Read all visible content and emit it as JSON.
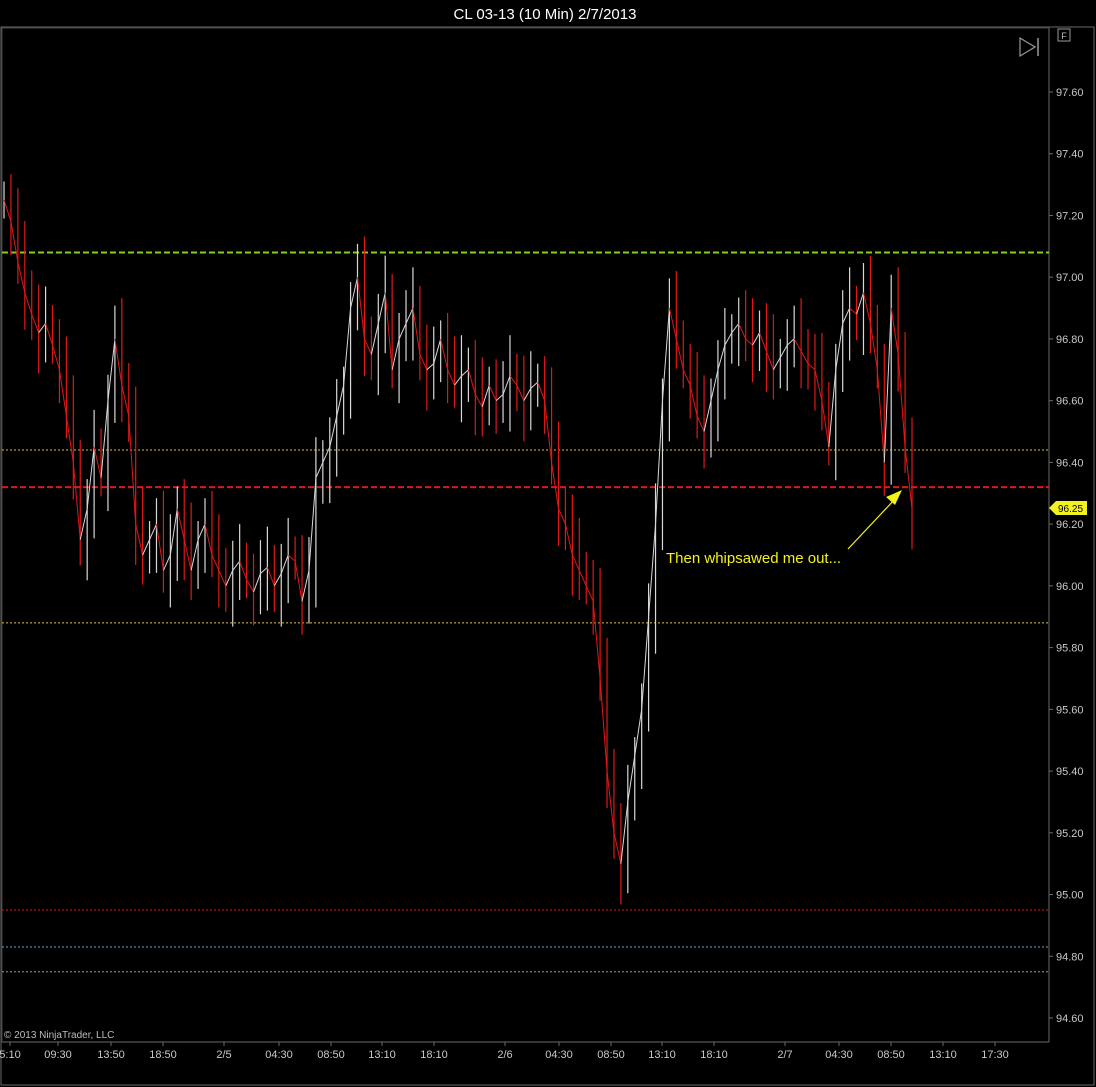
{
  "chart_data": {
    "type": "ohlc",
    "title": "CL 03-13 (10 Min)  2/7/2013",
    "watermark": "© 2013 NinjaTrader, LLC",
    "annotation": "Then whipsawed me out...",
    "current_price_label": "96.25",
    "x_tick_labels": [
      "5:10",
      "09:30",
      "13:50",
      "18:50",
      "2/5",
      "04:30",
      "08:50",
      "13:10",
      "18:10",
      "2/6",
      "04:30",
      "08:50",
      "13:10",
      "18:10",
      "2/7",
      "04:30",
      "08:50",
      "13:10",
      "17:30"
    ],
    "y_tick_labels": [
      "97.60",
      "97.40",
      "97.20",
      "97.00",
      "96.80",
      "96.60",
      "96.40",
      "96.20",
      "96.00",
      "95.80",
      "95.60",
      "95.40",
      "95.20",
      "95.00",
      "94.80",
      "94.60"
    ],
    "ylim": [
      94.55,
      97.8
    ],
    "grid": false,
    "horizontal_lines": [
      {
        "price": 97.08,
        "color": "#7fd21e",
        "style": "dashed"
      },
      {
        "price": 96.44,
        "color": "#d8c050",
        "style": "dotted"
      },
      {
        "price": 96.32,
        "color": "#e01818",
        "style": "dashed"
      },
      {
        "price": 95.88,
        "color": "#d8c050",
        "style": "dotted"
      },
      {
        "price": 94.95,
        "color": "#e01818",
        "style": "dotted"
      },
      {
        "price": 94.83,
        "color": "#6aa4c8",
        "style": "dotted"
      },
      {
        "price": 94.75,
        "color": "#6aa4c8",
        "style": "dotted"
      }
    ],
    "series": [
      {
        "name": "CL 03-13",
        "values": [
          97.25,
          97.18,
          97.05,
          96.95,
          96.88,
          96.82,
          96.85,
          96.78,
          96.7,
          96.55,
          96.4,
          96.15,
          96.25,
          96.45,
          96.35,
          96.6,
          96.8,
          96.65,
          96.55,
          96.2,
          96.1,
          96.15,
          96.2,
          96.05,
          96.1,
          96.25,
          96.15,
          96.05,
          96.15,
          96.2,
          96.1,
          96.05,
          96.0,
          96.05,
          96.08,
          96.02,
          95.98,
          96.04,
          96.06,
          96.0,
          96.04,
          96.1,
          96.08,
          95.95,
          96.05,
          96.35,
          96.4,
          96.45,
          96.55,
          96.65,
          96.9,
          97.0,
          96.8,
          96.75,
          96.85,
          96.95,
          96.7,
          96.8,
          96.85,
          96.9,
          96.75,
          96.7,
          96.72,
          96.8,
          96.7,
          96.65,
          96.68,
          96.7,
          96.62,
          96.58,
          96.65,
          96.6,
          96.62,
          96.68,
          96.65,
          96.6,
          96.64,
          96.66,
          96.6,
          96.4,
          96.25,
          96.2,
          96.1,
          96.05,
          96.0,
          95.95,
          95.7,
          95.4,
          95.2,
          95.1,
          95.3,
          95.45,
          95.6,
          95.9,
          96.2,
          96.6,
          96.9,
          96.8,
          96.7,
          96.65,
          96.55,
          96.5,
          96.6,
          96.7,
          96.78,
          96.82,
          96.85,
          96.8,
          96.78,
          96.82,
          96.76,
          96.7,
          96.74,
          96.78,
          96.8,
          96.76,
          96.72,
          96.7,
          96.6,
          96.45,
          96.7,
          96.85,
          96.9,
          96.88,
          96.95,
          96.85,
          96.7,
          96.4,
          96.9,
          96.75,
          96.45,
          96.25
        ]
      }
    ]
  }
}
